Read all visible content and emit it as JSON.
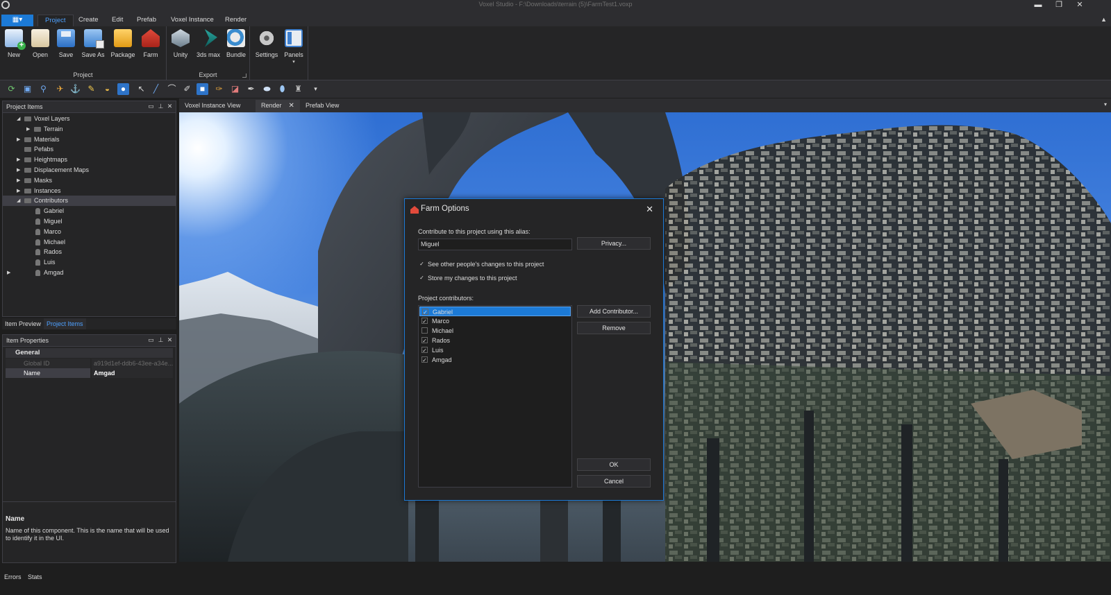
{
  "window": {
    "title": "Voxel Studio - F:\\Downloads\\terrain (5)\\FarmTest1.voxp",
    "minimize": "▬",
    "restore": "❐",
    "close": "✕"
  },
  "menu": {
    "file_label": "▦▾",
    "tabs": [
      {
        "label": "Project"
      },
      {
        "label": "Create"
      },
      {
        "label": "Edit"
      },
      {
        "label": "Prefab"
      },
      {
        "label": "Voxel Instance"
      },
      {
        "label": "Render"
      }
    ],
    "collapse_caret": "▲"
  },
  "ribbon": {
    "groups": [
      {
        "label": "Project",
        "buttons": [
          "New",
          "Open",
          "Save",
          "Save As",
          "Package",
          "Farm"
        ]
      },
      {
        "label": "Export",
        "buttons": [
          "Unity",
          "3ds max",
          "Bundle"
        ]
      },
      {
        "label": "",
        "buttons": [
          "Settings",
          "Panels"
        ]
      }
    ],
    "panels_caret": "▾"
  },
  "toolbar": {
    "icons": [
      "refresh-icon",
      "save-icon",
      "walk-icon",
      "dart-icon",
      "anchor-icon",
      "pencil-icon",
      "dome-icon",
      "sphere-icon",
      "pointer-icon",
      "line-icon",
      "curve-icon",
      "brush-icon",
      "box-icon",
      "paint-icon",
      "eraser-icon",
      "dropper-icon",
      "ellipse-icon",
      "blob-icon",
      "tower-icon",
      "overflow-icon"
    ],
    "glyphs": [
      "⟳",
      "▣",
      "⚲",
      "✈",
      "⚓",
      "✎",
      "◒",
      "●",
      "↖",
      "╱",
      "⌒",
      "✐",
      "■",
      "✑",
      "◪",
      "✒",
      "⬬",
      "⬮",
      "♜",
      "▾"
    ]
  },
  "project_items": {
    "title": "Project Items",
    "tree": [
      {
        "label": "Voxel Layers",
        "level": 1,
        "arrow": "◢"
      },
      {
        "label": "Terrain",
        "level": 2,
        "arrow": "▶"
      },
      {
        "label": "Materials",
        "level": 1,
        "arrow": "▶"
      },
      {
        "label": "Pefabs",
        "level": 1,
        "arrow": ""
      },
      {
        "label": "Heightmaps",
        "level": 1,
        "arrow": "▶"
      },
      {
        "label": "Displacement Maps",
        "level": 1,
        "arrow": "▶"
      },
      {
        "label": "Masks",
        "level": 1,
        "arrow": "▶"
      },
      {
        "label": "Instances",
        "level": 1,
        "arrow": "▶"
      },
      {
        "label": "Contributors",
        "level": 1,
        "arrow": "◢"
      },
      {
        "label": "Gabriel",
        "level": 2,
        "arrow": ""
      },
      {
        "label": "Miguel",
        "level": 2,
        "arrow": ""
      },
      {
        "label": "Marco",
        "level": 2,
        "arrow": ""
      },
      {
        "label": "Michael",
        "level": 2,
        "arrow": ""
      },
      {
        "label": "Rados",
        "level": 2,
        "arrow": ""
      },
      {
        "label": "Luis",
        "level": 2,
        "arrow": ""
      },
      {
        "label": "Amgad",
        "level": 2,
        "arrow": "▶"
      }
    ],
    "subtabs": [
      "Item Preview",
      "Project Items"
    ]
  },
  "item_properties": {
    "title": "Item Properties",
    "group": "General",
    "rows": [
      {
        "key": "Global ID",
        "value": "a919d1ef-ddb6-43ee-a34e..."
      },
      {
        "key": "Name",
        "value": "Amgad"
      }
    ],
    "description_title": "Name",
    "description": "Name of this component. This is the name that will be used to identify it in the UI."
  },
  "doc_tabs": {
    "tabs": [
      "Voxel Instance View",
      "Render",
      "Prefab View"
    ],
    "close_glyph": "✕",
    "caret": "▾"
  },
  "dialog": {
    "title": "Farm Options",
    "close": "✕",
    "alias_label": "Contribute to this project using this alias:",
    "alias_value": "Miguel",
    "privacy_button": "Privacy...",
    "see_changes": "See other people's changes to this project",
    "store_changes": "Store my changes to this project",
    "contributors_label": "Project contributors:",
    "contributors": [
      {
        "name": "Gabriel",
        "checked": true
      },
      {
        "name": "Marco",
        "checked": true
      },
      {
        "name": "Michael",
        "checked": false
      },
      {
        "name": "Rados",
        "checked": true
      },
      {
        "name": "Luis",
        "checked": true
      },
      {
        "name": "Amgad",
        "checked": true
      }
    ],
    "check_glyph": "✓",
    "add_button": "Add Contributor...",
    "remove_button": "Remove",
    "ok_button": "OK",
    "cancel_button": "Cancel"
  },
  "statusbar": {
    "items": [
      "Errors",
      "Stats"
    ]
  }
}
